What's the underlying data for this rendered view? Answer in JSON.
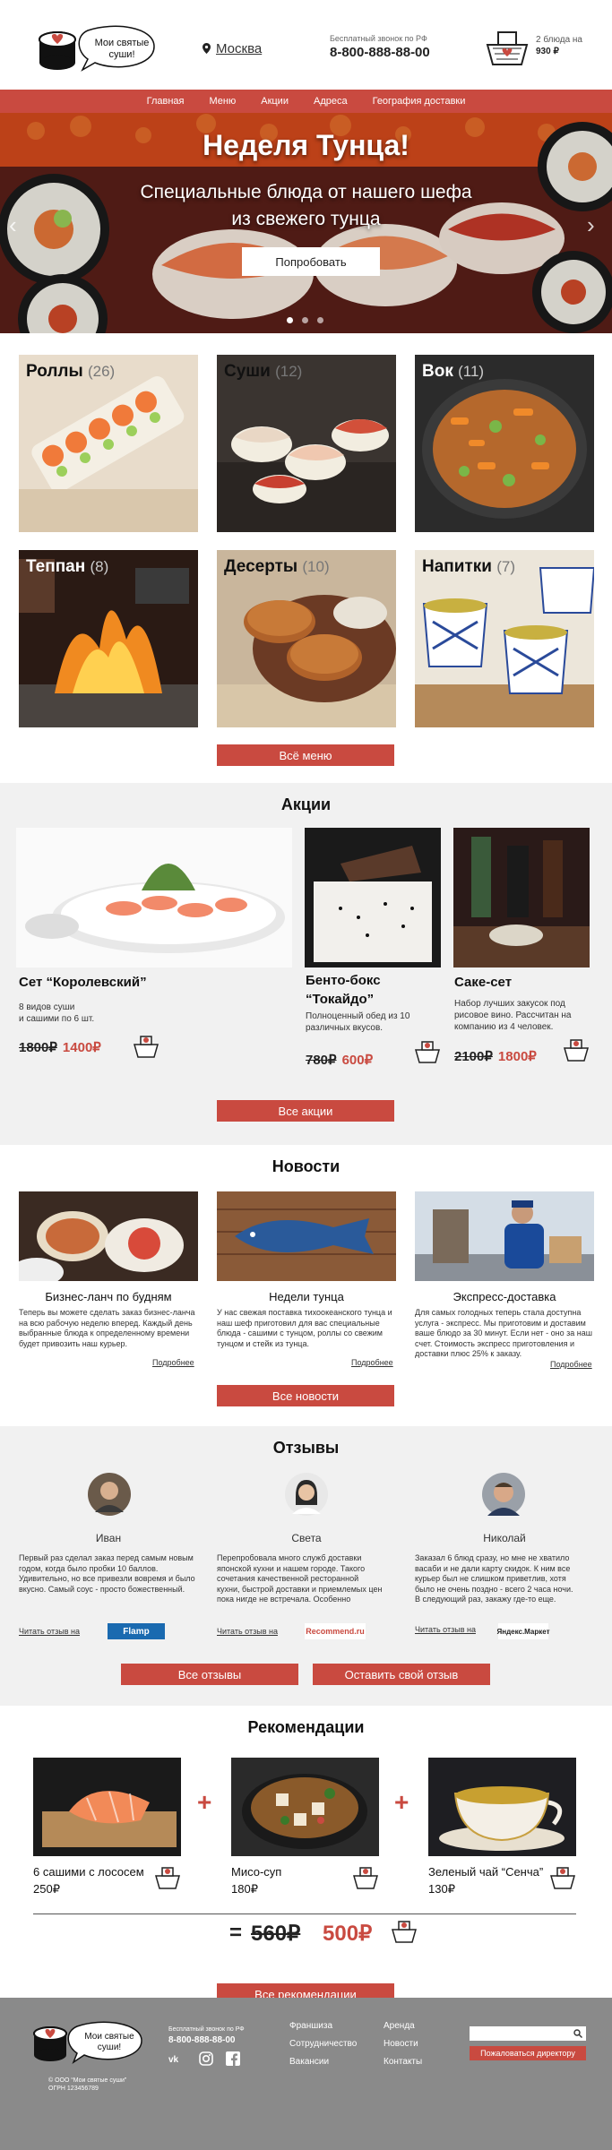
{
  "header": {
    "logo_text": "Мои святые суши!",
    "city": "Москва",
    "phone_caption": "Бесплатный звонок по РФ",
    "phone": "8-800-888-88-00",
    "cart_count": "2 блюда на",
    "cart_sum": "930 ₽"
  },
  "nav": [
    "Главная",
    "Меню",
    "Акции",
    "Адреса",
    "География доставки"
  ],
  "hero": {
    "title": "Неделя Тунца!",
    "subtitle_1": "Специальные блюда от нашего шефа",
    "subtitle_2": "из свежего тунца",
    "button": "Попробовать"
  },
  "categories": [
    {
      "name": "Роллы",
      "count": "(26)"
    },
    {
      "name": "Суши",
      "count": "(12)"
    },
    {
      "name": "Вок",
      "count": "(11)"
    },
    {
      "name": "Теппан",
      "count": "(8)"
    },
    {
      "name": "Десерты",
      "count": "(10)"
    },
    {
      "name": "Напитки",
      "count": "(7)"
    }
  ],
  "menu_button": "Всё меню",
  "promos": {
    "title": "Акции",
    "items": [
      {
        "title": "Сет “Королевский”",
        "desc_1": "8 видов суши",
        "desc_2": "и сашими по 6 шт.",
        "old": "1800₽",
        "new": "1400₽"
      },
      {
        "title_1": "Бенто-бокс",
        "title_2": "“Токайдо”",
        "desc_1": "Полноценный обед из 10",
        "desc_2": "различных вкусов.",
        "old": "780₽",
        "new": "600₽"
      },
      {
        "title": "Саке-сет",
        "desc_1": "Набор лучших закусок под",
        "desc_2": "рисовое вино. Рассчитан на",
        "desc_3": "компанию из 4 человек.",
        "old": "2100₽",
        "new": "1800₽"
      }
    ],
    "button": "Все акции"
  },
  "news": {
    "title": "Новости",
    "items": [
      {
        "title": "Бизнес-ланч по будням",
        "lines": [
          "Теперь вы можете сделать заказ бизнес-ланча",
          "на всю рабочую неделю вперед. Каждый день",
          "выбранные блюда к определенному времени",
          "будет привозить наш курьер."
        ],
        "more": "Подробнее"
      },
      {
        "title": "Недели тунца",
        "lines": [
          "У нас свежая поставка тихоокеанского тунца и",
          "наш шеф приготовил для вас специальные",
          "блюда - сашими с тунцом, роллы со свежим",
          "тунцом и стейк из тунца."
        ],
        "more": "Подробнее"
      },
      {
        "title": "Экспресс-доставка",
        "lines": [
          "Для самых голодных теперь стала доступна",
          "услуга - экспресс. Мы приготовим и доставим",
          "ваше блюдо за 30 минут. Если нет - оно за наш",
          "счет. Стоимость экспресс приготовления и",
          "доставки плюс 25% к заказу."
        ],
        "more": "Подробнее"
      }
    ],
    "button": "Все новости"
  },
  "reviews": {
    "title": "Отзывы",
    "items": [
      {
        "name": "Иван",
        "lines": [
          "Первый раз сделал заказ перед самым новым",
          "годом, когда было пробки 10 баллов.",
          "Удивительно, но все привезли вовремя и было",
          "вкусно. Самый соус - просто божественный."
        ],
        "link": "Читать отзыв на",
        "badge": "Flamp"
      },
      {
        "name": "Света",
        "lines": [
          "Перепробовала много служб доставки",
          "японской кухни и нашем городе. Такого",
          "сочетания качественной ресторанной",
          "кухни, быстрой доставки и приемлемых цен",
          "пока нигде не встречала. Особенно"
        ],
        "link": "Читать отзыв на",
        "badge": "Recommend.ru"
      },
      {
        "name": "Николай",
        "lines": [
          "Заказал 6 блюд сразу, но мне не хватило",
          "васаби и не дали карту скидок. К ним все",
          "курьер был не слишком приветлив, хотя",
          "было не очень поздно - всего 2 часа ночи.",
          "В следующий раз, закажу где-то еще."
        ],
        "link": "Читать отзыв на",
        "badge": "Яндекс.Маркет"
      }
    ],
    "button_all": "Все отзывы",
    "button_leave": "Оставить свой отзыв"
  },
  "recs": {
    "title": "Рекомендации",
    "items": [
      {
        "name": "6 сашими с лососем",
        "price": "250₽"
      },
      {
        "name": "Мисо-суп",
        "price": "180₽"
      },
      {
        "name": "Зеленый чай “Сенча”",
        "price": "130₽"
      }
    ],
    "old_total": "560₽",
    "eq": "=",
    "new_total": "500₽",
    "button": "Все рекомендации"
  },
  "footer": {
    "logo_text": "Мои святые суши!",
    "phone_caption": "Бесплатный звонок по РФ",
    "phone": "8-800-888-88-00",
    "col1": [
      "Франшиза",
      "Сотрудничество",
      "Вакансии"
    ],
    "col2": [
      "Аренда",
      "Новости",
      "Контакты"
    ],
    "complain": "Пожаловаться директору",
    "copy_1": "© ООО “Мои святые суши”",
    "copy_2": "ОГРН 123456789"
  },
  "colors": {
    "accent": "#c94a40",
    "footer": "#8a8a8a",
    "section_gray": "#f1f1f1"
  }
}
